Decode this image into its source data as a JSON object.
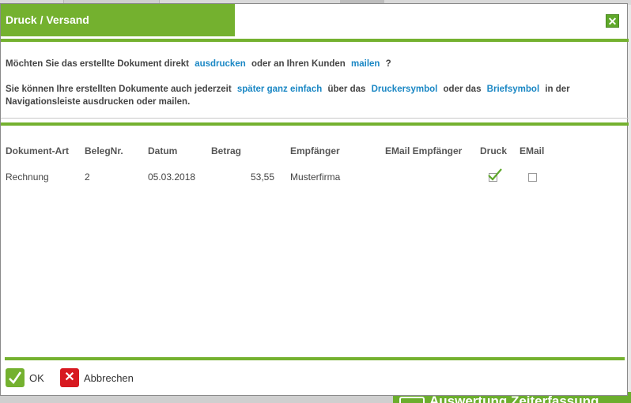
{
  "background": {
    "bottom_right_text": "Auswertung Zeiterfassung"
  },
  "dialog": {
    "title": "Druck / Versand",
    "close_icon": "close-icon",
    "message1": {
      "before": "Möchten Sie das erstellte Dokument direkt",
      "link_print": "ausdrucken",
      "middle": "oder an Ihren Kunden",
      "link_mail": "mailen",
      "after": "?"
    },
    "message2": {
      "before": "Sie können Ihre erstellten Dokumente auch jederzeit",
      "link_later": "später ganz einfach",
      "middle1": "über das",
      "link_printer": "Druckersymbol",
      "middle2": "oder das",
      "link_letter": "Briefsymbol",
      "after": "in der Navigationsleiste ausdrucken oder mailen."
    },
    "table": {
      "headers": [
        "Dokument-Art",
        "BelegNr.",
        "Datum",
        "Betrag",
        "Empfänger",
        "EMail Empfänger",
        "Druck",
        "EMail"
      ],
      "rows": [
        {
          "doc_type": "Rechnung",
          "number": "2",
          "date": "05.03.2018",
          "amount": "53,55",
          "recipient": "Musterfirma",
          "email": "",
          "print_checked": true,
          "email_checked": false
        }
      ]
    },
    "buttons": {
      "ok": "OK",
      "cancel": "Abbrechen"
    }
  },
  "colors": {
    "accent": "#74b12f",
    "link": "#1a87c4",
    "cancel": "#d71920"
  }
}
